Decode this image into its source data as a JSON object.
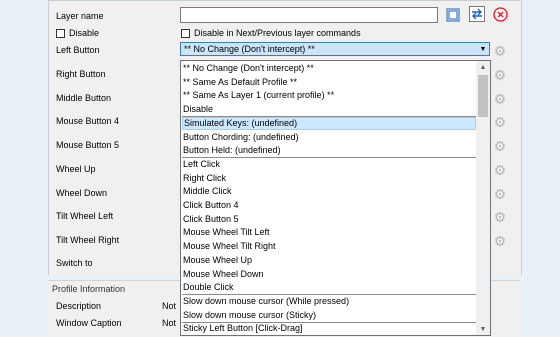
{
  "form": {
    "layer_name_label": "Layer name",
    "layer_name_value": "",
    "disable_label": "Disable",
    "disable_nav_label": "Disable in Next/Previous layer commands",
    "rows": [
      {
        "id": "left-button",
        "label": "Left Button"
      },
      {
        "id": "right-button",
        "label": "Right Button"
      },
      {
        "id": "middle-button",
        "label": "Middle Button"
      },
      {
        "id": "mouse-button-4",
        "label": "Mouse Button 4"
      },
      {
        "id": "mouse-button-5",
        "label": "Mouse Button 5"
      },
      {
        "id": "wheel-up",
        "label": "Wheel Up"
      },
      {
        "id": "wheel-down",
        "label": "Wheel Down"
      },
      {
        "id": "tilt-wheel-left",
        "label": "Tilt Wheel Left"
      },
      {
        "id": "tilt-wheel-right",
        "label": "Tilt Wheel Right"
      },
      {
        "id": "switch-to",
        "label": "Switch to"
      }
    ]
  },
  "combo": {
    "selected": "** No Change (Don't intercept) **"
  },
  "dropdown": {
    "items": [
      "** No Change (Don't intercept) **",
      "** Same As Default Profile **",
      "** Same As Layer 1 (current profile) **",
      "Disable",
      "Simulated Keys: (undefined)",
      "Button Chording: (undefined)",
      "Button Held: (undefined)",
      "Left Click",
      "Right Click",
      "Middle Click",
      "Click Button 4",
      "Click Button 5",
      "Mouse Wheel Tilt Left",
      "Mouse Wheel Tilt Right",
      "Mouse Wheel Up",
      "Mouse Wheel Down",
      "Double Click",
      "Slow down mouse cursor (While pressed)",
      "Slow down mouse cursor (Sticky)",
      "Sticky Left Button [Click-Drag]"
    ],
    "highlighted_index": 4,
    "separators_after": [
      3,
      6,
      16,
      18
    ]
  },
  "profile_info": {
    "heading": "Profile Information",
    "description_label": "Description",
    "description_value": "Not",
    "window_caption_label": "Window Caption",
    "window_caption_value": "Not"
  },
  "colors": {
    "combo_bg": "#cde3f7",
    "highlight_bg": "#cce8ff",
    "delete_icon": "#e81123",
    "swap_icon": "#1f5fbf"
  },
  "icons": [
    "copy-icon",
    "swap-icon",
    "delete-icon",
    "gear-icon",
    "chevron-down-icon",
    "scroll-up-icon",
    "scroll-down-icon"
  ]
}
